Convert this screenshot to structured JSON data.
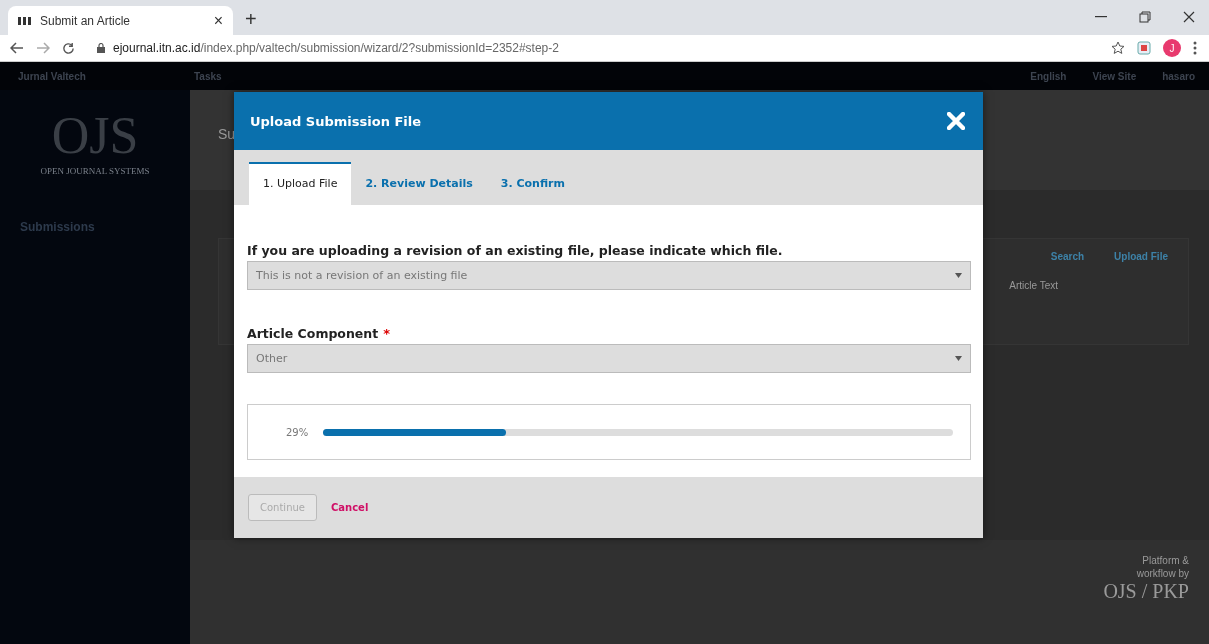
{
  "browser": {
    "tab_title": "Submit an Article",
    "tab_close": "×",
    "new_tab": "+",
    "url_host": "ejournal.itn.ac.id",
    "url_path": "/index.php/valtech/submission/wizard/2?submissionId=2352#step-2",
    "profile_initial": "J"
  },
  "top_nav": {
    "journal": "Jurnal Valtech",
    "tasks": "Tasks",
    "language": "English",
    "view_site": "View Site",
    "user": "hasaro"
  },
  "sidebar": {
    "logo": "OJS",
    "logo_subtitle": "OPEN JOURNAL SYSTEMS",
    "nav_item": "Submissions"
  },
  "page": {
    "title": "Su",
    "search": "Search",
    "upload": "Upload File",
    "row_text": "Article Text"
  },
  "footer": {
    "line1": "Platform &",
    "line2": "workflow by",
    "logo": "OJS / PKP"
  },
  "modal": {
    "title": "Upload Submission File",
    "tabs": [
      {
        "label": "1. Upload File",
        "selected": true
      },
      {
        "label": "2. Review Details",
        "selected": false
      },
      {
        "label": "3. Confirm",
        "selected": false
      }
    ],
    "revision_field": {
      "label": "If you are uploading a revision of an existing file, please indicate which file.",
      "value": "This is not a revision of an existing file"
    },
    "component_field": {
      "label": "Article Component",
      "required_mark": "*",
      "value": "Other"
    },
    "progress": {
      "reading": "29%",
      "level": 0.29
    },
    "continue_button": {
      "label": "Continue",
      "disabled": true
    },
    "cancel": "Cancel"
  }
}
